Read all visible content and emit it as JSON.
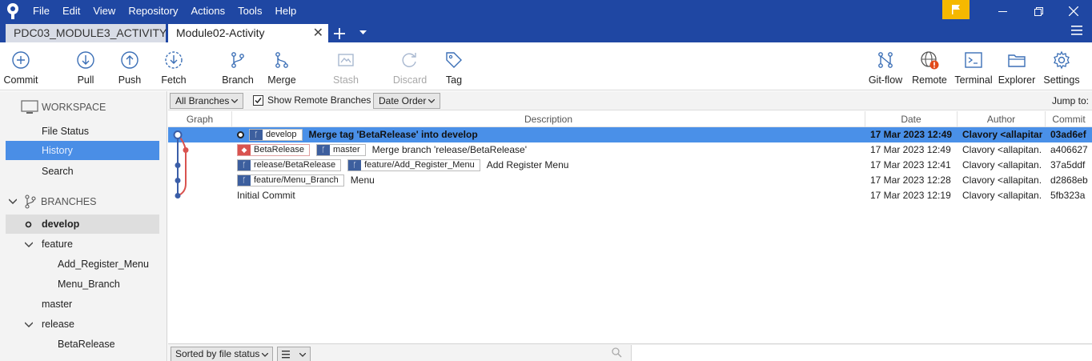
{
  "menu": [
    "File",
    "Edit",
    "View",
    "Repository",
    "Actions",
    "Tools",
    "Help"
  ],
  "tabs": [
    {
      "label": "PDC03_MODULE3_ACTIVITY"
    },
    {
      "label": "Module02-Activity"
    }
  ],
  "tab_close": "✕",
  "toolbar": {
    "commit": "Commit",
    "pull": "Pull",
    "push": "Push",
    "fetch": "Fetch",
    "branch": "Branch",
    "merge": "Merge",
    "stash": "Stash",
    "discard": "Discard",
    "tag": "Tag",
    "gitflow": "Git-flow",
    "remote": "Remote",
    "terminal": "Terminal",
    "explorer": "Explorer",
    "settings": "Settings"
  },
  "sidebar": {
    "workspace": "WORKSPACE",
    "file_status": "File Status",
    "history": "History",
    "search": "Search",
    "branches": "BRANCHES",
    "develop": "develop",
    "feature": "feature",
    "add_register_menu": "Add_Register_Menu",
    "menu_branch": "Menu_Branch",
    "master": "master",
    "release": "release",
    "beta_release": "BetaRelease"
  },
  "filter": {
    "all_branches": "All Branches",
    "show_remote": "Show Remote Branches",
    "show_remote_checked": true,
    "order": "Date Order",
    "jump_to": "Jump to:"
  },
  "columns": {
    "graph": "Graph",
    "description": "Description",
    "date": "Date",
    "author": "Author",
    "commit": "Commit"
  },
  "commits": [
    {
      "refs": [
        {
          "type": "branch",
          "label": "develop",
          "current": true
        }
      ],
      "message": "Merge tag 'BetaRelease' into develop",
      "date": "17 Mar 2023 12:49",
      "author": "Clavory <allapitan",
      "hash": "03ad6ef",
      "selected": true
    },
    {
      "refs": [
        {
          "type": "tag",
          "label": "BetaRelease"
        },
        {
          "type": "branch",
          "label": "master"
        }
      ],
      "message": "Merge branch 'release/BetaRelease'",
      "date": "17 Mar 2023 12:49",
      "author": "Clavory <allapitan.",
      "hash": "a406627"
    },
    {
      "refs": [
        {
          "type": "branch",
          "label": "release/BetaRelease"
        },
        {
          "type": "branch",
          "label": "feature/Add_Register_Menu"
        }
      ],
      "message": "Add Register Menu",
      "date": "17 Mar 2023 12:41",
      "author": "Clavory <allapitan.",
      "hash": "37a5ddf"
    },
    {
      "refs": [
        {
          "type": "branch",
          "label": "feature/Menu_Branch"
        }
      ],
      "message": "Menu",
      "date": "17 Mar 2023 12:28",
      "author": "Clavory <allapitan.",
      "hash": "d2868eb"
    },
    {
      "refs": [],
      "message": "Initial Commit",
      "date": "17 Mar 2023 12:19",
      "author": "Clavory <allapitan.",
      "hash": "5fb323a"
    }
  ],
  "bottom": {
    "sort": "Sorted by file status"
  },
  "colors": {
    "titlebar": "#1f47a3",
    "selection": "#4a90e8",
    "graph_blue": "#3b5ea8",
    "graph_red": "#d9534f"
  }
}
